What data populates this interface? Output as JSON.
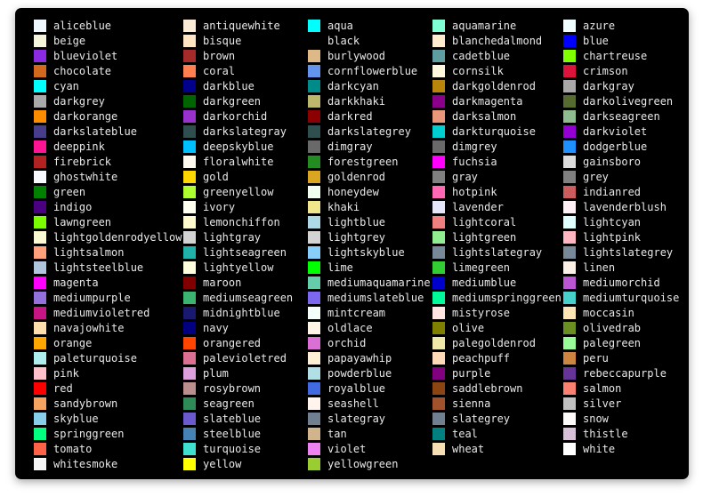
{
  "columns": [
    [
      {
        "name": "aliceblue",
        "color": "#F0F8FF"
      },
      {
        "name": "beige",
        "color": "#F5F5DC"
      },
      {
        "name": "blueviolet",
        "color": "#8A2BE2"
      },
      {
        "name": "chocolate",
        "color": "#D2691E"
      },
      {
        "name": "cyan",
        "color": "#00FFFF"
      },
      {
        "name": "darkgrey",
        "color": "#A9A9A9"
      },
      {
        "name": "darkorange",
        "color": "#FF8C00"
      },
      {
        "name": "darkslateblue",
        "color": "#483D8B"
      },
      {
        "name": "deeppink",
        "color": "#FF1493"
      },
      {
        "name": "firebrick",
        "color": "#B22222"
      },
      {
        "name": "ghostwhite",
        "color": "#F8F8FF"
      },
      {
        "name": "green",
        "color": "#008000"
      },
      {
        "name": "indigo",
        "color": "#4B0082"
      },
      {
        "name": "lawngreen",
        "color": "#7CFC00"
      },
      {
        "name": "lightgoldenrodyellow",
        "color": "#FAFAD2"
      },
      {
        "name": "lightsalmon",
        "color": "#FFA07A"
      },
      {
        "name": "lightsteelblue",
        "color": "#B0C4DE"
      },
      {
        "name": "magenta",
        "color": "#FF00FF"
      },
      {
        "name": "mediumpurple",
        "color": "#9370DB"
      },
      {
        "name": "mediumvioletred",
        "color": "#C71585"
      },
      {
        "name": "navajowhite",
        "color": "#FFDEAD"
      },
      {
        "name": "orange",
        "color": "#FFA500"
      },
      {
        "name": "paleturquoise",
        "color": "#AFEEEE"
      },
      {
        "name": "pink",
        "color": "#FFC0CB"
      },
      {
        "name": "red",
        "color": "#FF0000"
      },
      {
        "name": "sandybrown",
        "color": "#F4A460"
      },
      {
        "name": "skyblue",
        "color": "#87CEEB"
      },
      {
        "name": "springgreen",
        "color": "#00FF7F"
      },
      {
        "name": "tomato",
        "color": "#FF6347"
      },
      {
        "name": "whitesmoke",
        "color": "#F5F5F5"
      }
    ],
    [
      {
        "name": "antiquewhite",
        "color": "#FAEBD7"
      },
      {
        "name": "bisque",
        "color": "#FFE4C4"
      },
      {
        "name": "brown",
        "color": "#A52A2A"
      },
      {
        "name": "coral",
        "color": "#FF7F50"
      },
      {
        "name": "darkblue",
        "color": "#00008B"
      },
      {
        "name": "darkgreen",
        "color": "#006400"
      },
      {
        "name": "darkorchid",
        "color": "#9932CC"
      },
      {
        "name": "darkslategray",
        "color": "#2F4F4F"
      },
      {
        "name": "deepskyblue",
        "color": "#00BFFF"
      },
      {
        "name": "floralwhite",
        "color": "#FFFAF0"
      },
      {
        "name": "gold",
        "color": "#FFD700"
      },
      {
        "name": "greenyellow",
        "color": "#ADFF2F"
      },
      {
        "name": "ivory",
        "color": "#FFFFF0"
      },
      {
        "name": "lemonchiffon",
        "color": "#FFFACD"
      },
      {
        "name": "lightgray",
        "color": "#D3D3D3"
      },
      {
        "name": "lightseagreen",
        "color": "#20B2AA"
      },
      {
        "name": "lightyellow",
        "color": "#FFFFE0"
      },
      {
        "name": "maroon",
        "color": "#800000"
      },
      {
        "name": "mediumseagreen",
        "color": "#3CB371"
      },
      {
        "name": "midnightblue",
        "color": "#191970"
      },
      {
        "name": "navy",
        "color": "#000080"
      },
      {
        "name": "orangered",
        "color": "#FF4500"
      },
      {
        "name": "palevioletred",
        "color": "#DB7093"
      },
      {
        "name": "plum",
        "color": "#DDA0DD"
      },
      {
        "name": "rosybrown",
        "color": "#BC8F8F"
      },
      {
        "name": "seagreen",
        "color": "#2E8B57"
      },
      {
        "name": "slateblue",
        "color": "#6A5ACD"
      },
      {
        "name": "steelblue",
        "color": "#4682B4"
      },
      {
        "name": "turquoise",
        "color": "#40E0D0"
      },
      {
        "name": "yellow",
        "color": "#FFFF00"
      }
    ],
    [
      {
        "name": "aqua",
        "color": "#00FFFF"
      },
      {
        "name": "black",
        "color": "#000000"
      },
      {
        "name": "burlywood",
        "color": "#DEB887"
      },
      {
        "name": "cornflowerblue",
        "color": "#6495ED"
      },
      {
        "name": "darkcyan",
        "color": "#008B8B"
      },
      {
        "name": "darkkhaki",
        "color": "#BDB76B"
      },
      {
        "name": "darkred",
        "color": "#8B0000"
      },
      {
        "name": "darkslategrey",
        "color": "#2F4F4F"
      },
      {
        "name": "dimgray",
        "color": "#696969"
      },
      {
        "name": "forestgreen",
        "color": "#228B22"
      },
      {
        "name": "goldenrod",
        "color": "#DAA520"
      },
      {
        "name": "honeydew",
        "color": "#F0FFF0"
      },
      {
        "name": "khaki",
        "color": "#F0E68C"
      },
      {
        "name": "lightblue",
        "color": "#ADD8E6"
      },
      {
        "name": "lightgrey",
        "color": "#D3D3D3"
      },
      {
        "name": "lightskyblue",
        "color": "#87CEFA"
      },
      {
        "name": "lime",
        "color": "#00FF00"
      },
      {
        "name": "mediumaquamarine",
        "color": "#66CDAA"
      },
      {
        "name": "mediumslateblue",
        "color": "#7B68EE"
      },
      {
        "name": "mintcream",
        "color": "#F5FFFA"
      },
      {
        "name": "oldlace",
        "color": "#FDF5E6"
      },
      {
        "name": "orchid",
        "color": "#DA70D6"
      },
      {
        "name": "papayawhip",
        "color": "#FFEFD5"
      },
      {
        "name": "powderblue",
        "color": "#B0E0E6"
      },
      {
        "name": "royalblue",
        "color": "#4169E1"
      },
      {
        "name": "seashell",
        "color": "#FFF5EE"
      },
      {
        "name": "slategray",
        "color": "#708090"
      },
      {
        "name": "tan",
        "color": "#D2B48C"
      },
      {
        "name": "violet",
        "color": "#EE82EE"
      },
      {
        "name": "yellowgreen",
        "color": "#9ACD32"
      }
    ],
    [
      {
        "name": "aquamarine",
        "color": "#7FFFD4"
      },
      {
        "name": "blanchedalmond",
        "color": "#FFEBCD"
      },
      {
        "name": "cadetblue",
        "color": "#5F9EA0"
      },
      {
        "name": "cornsilk",
        "color": "#FFF8DC"
      },
      {
        "name": "darkgoldenrod",
        "color": "#B8860B"
      },
      {
        "name": "darkmagenta",
        "color": "#8B008B"
      },
      {
        "name": "darksalmon",
        "color": "#E9967A"
      },
      {
        "name": "darkturquoise",
        "color": "#00CED1"
      },
      {
        "name": "dimgrey",
        "color": "#696969"
      },
      {
        "name": "fuchsia",
        "color": "#FF00FF"
      },
      {
        "name": "gray",
        "color": "#808080"
      },
      {
        "name": "hotpink",
        "color": "#FF69B4"
      },
      {
        "name": "lavender",
        "color": "#E6E6FA"
      },
      {
        "name": "lightcoral",
        "color": "#F08080"
      },
      {
        "name": "lightgreen",
        "color": "#90EE90"
      },
      {
        "name": "lightslategray",
        "color": "#778899"
      },
      {
        "name": "limegreen",
        "color": "#32CD32"
      },
      {
        "name": "mediumblue",
        "color": "#0000CD"
      },
      {
        "name": "mediumspringgreen",
        "color": "#00FA9A"
      },
      {
        "name": "mistyrose",
        "color": "#FFE4E1"
      },
      {
        "name": "olive",
        "color": "#808000"
      },
      {
        "name": "palegoldenrod",
        "color": "#EEE8AA"
      },
      {
        "name": "peachpuff",
        "color": "#FFDAB9"
      },
      {
        "name": "purple",
        "color": "#800080"
      },
      {
        "name": "saddlebrown",
        "color": "#8B4513"
      },
      {
        "name": "sienna",
        "color": "#A0522D"
      },
      {
        "name": "slategrey",
        "color": "#708090"
      },
      {
        "name": "teal",
        "color": "#008080"
      },
      {
        "name": "wheat",
        "color": "#F5DEB3"
      }
    ],
    [
      {
        "name": "azure",
        "color": "#F0FFFF"
      },
      {
        "name": "blue",
        "color": "#0000FF"
      },
      {
        "name": "chartreuse",
        "color": "#7FFF00"
      },
      {
        "name": "crimson",
        "color": "#DC143C"
      },
      {
        "name": "darkgray",
        "color": "#A9A9A9"
      },
      {
        "name": "darkolivegreen",
        "color": "#556B2F"
      },
      {
        "name": "darkseagreen",
        "color": "#8FBC8F"
      },
      {
        "name": "darkviolet",
        "color": "#9400D3"
      },
      {
        "name": "dodgerblue",
        "color": "#1E90FF"
      },
      {
        "name": "gainsboro",
        "color": "#DCDCDC"
      },
      {
        "name": "grey",
        "color": "#808080"
      },
      {
        "name": "indianred",
        "color": "#CD5C5C"
      },
      {
        "name": "lavenderblush",
        "color": "#FFF0F5"
      },
      {
        "name": "lightcyan",
        "color": "#E0FFFF"
      },
      {
        "name": "lightpink",
        "color": "#FFB6C1"
      },
      {
        "name": "lightslategrey",
        "color": "#778899"
      },
      {
        "name": "linen",
        "color": "#FAF0E6"
      },
      {
        "name": "mediumorchid",
        "color": "#BA55D3"
      },
      {
        "name": "mediumturquoise",
        "color": "#48D1CC"
      },
      {
        "name": "moccasin",
        "color": "#FFE4B5"
      },
      {
        "name": "olivedrab",
        "color": "#6B8E23"
      },
      {
        "name": "palegreen",
        "color": "#98FB98"
      },
      {
        "name": "peru",
        "color": "#CD853F"
      },
      {
        "name": "rebeccapurple",
        "color": "#663399"
      },
      {
        "name": "salmon",
        "color": "#FA8072"
      },
      {
        "name": "silver",
        "color": "#C0C0C0"
      },
      {
        "name": "snow",
        "color": "#FFFAFA"
      },
      {
        "name": "thistle",
        "color": "#D8BFD8"
      },
      {
        "name": "white",
        "color": "#FFFFFF"
      }
    ]
  ]
}
